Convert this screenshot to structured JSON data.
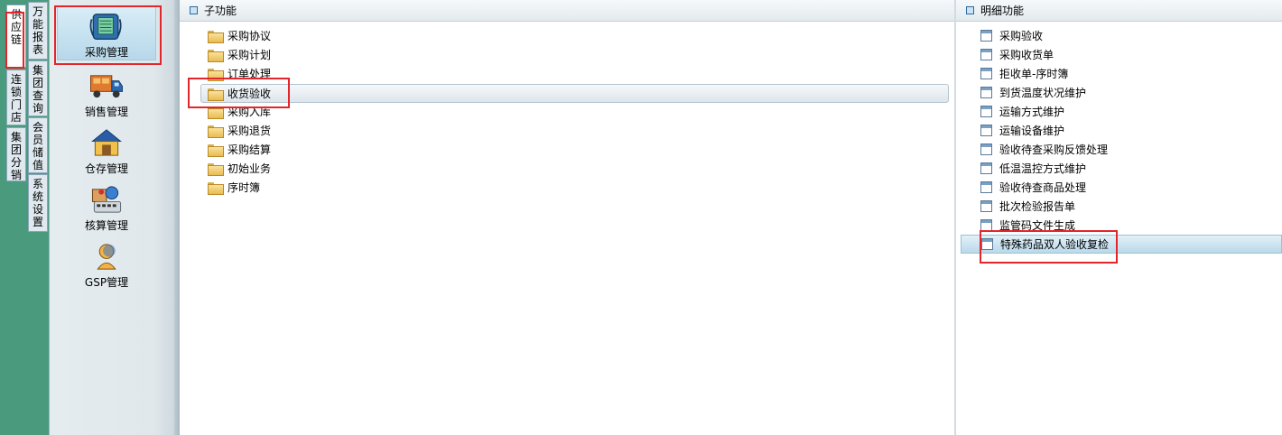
{
  "left_tabs": [
    {
      "label": "供应链",
      "active": true
    },
    {
      "label": "连锁门店",
      "active": false
    },
    {
      "label": "集团分销",
      "active": false
    }
  ],
  "right_tabs": [
    {
      "label": "万能报表"
    },
    {
      "label": "集团查询"
    },
    {
      "label": "会员储值"
    },
    {
      "label": "系统设置"
    }
  ],
  "modules": [
    {
      "label": "采购管理",
      "icon": "purchase-register-icon",
      "active": true
    },
    {
      "label": "销售管理",
      "icon": "delivery-truck-icon",
      "active": false
    },
    {
      "label": "仓存管理",
      "icon": "warehouse-icon",
      "active": false
    },
    {
      "label": "核算管理",
      "icon": "accounting-icon",
      "active": false
    },
    {
      "label": "GSP管理",
      "icon": "gsp-person-icon",
      "active": false
    }
  ],
  "sub_panel": {
    "title": "子功能",
    "items": [
      "采购协议",
      "采购计划",
      "订单处理",
      "收货验收",
      "采购入库",
      "采购退货",
      "采购结算",
      "初始业务",
      "序时簿"
    ],
    "selected": "收货验收"
  },
  "detail_panel": {
    "title": "明细功能",
    "items": [
      "采购验收",
      "采购收货单",
      "拒收单-序时簿",
      "到货温度状况维护",
      "运输方式维护",
      "运输设备维护",
      "验收待查采购反馈处理",
      "低温温控方式维护",
      "验收待查商品处理",
      "批次检验报告单",
      "监管码文件生成",
      "特殊药品双人验收复检"
    ],
    "selected": "特殊药品双人验收复检"
  },
  "colors": {
    "annotation": "#e3262b",
    "left_strip": "#4a9b7d",
    "selection": "#b9d9ea"
  }
}
